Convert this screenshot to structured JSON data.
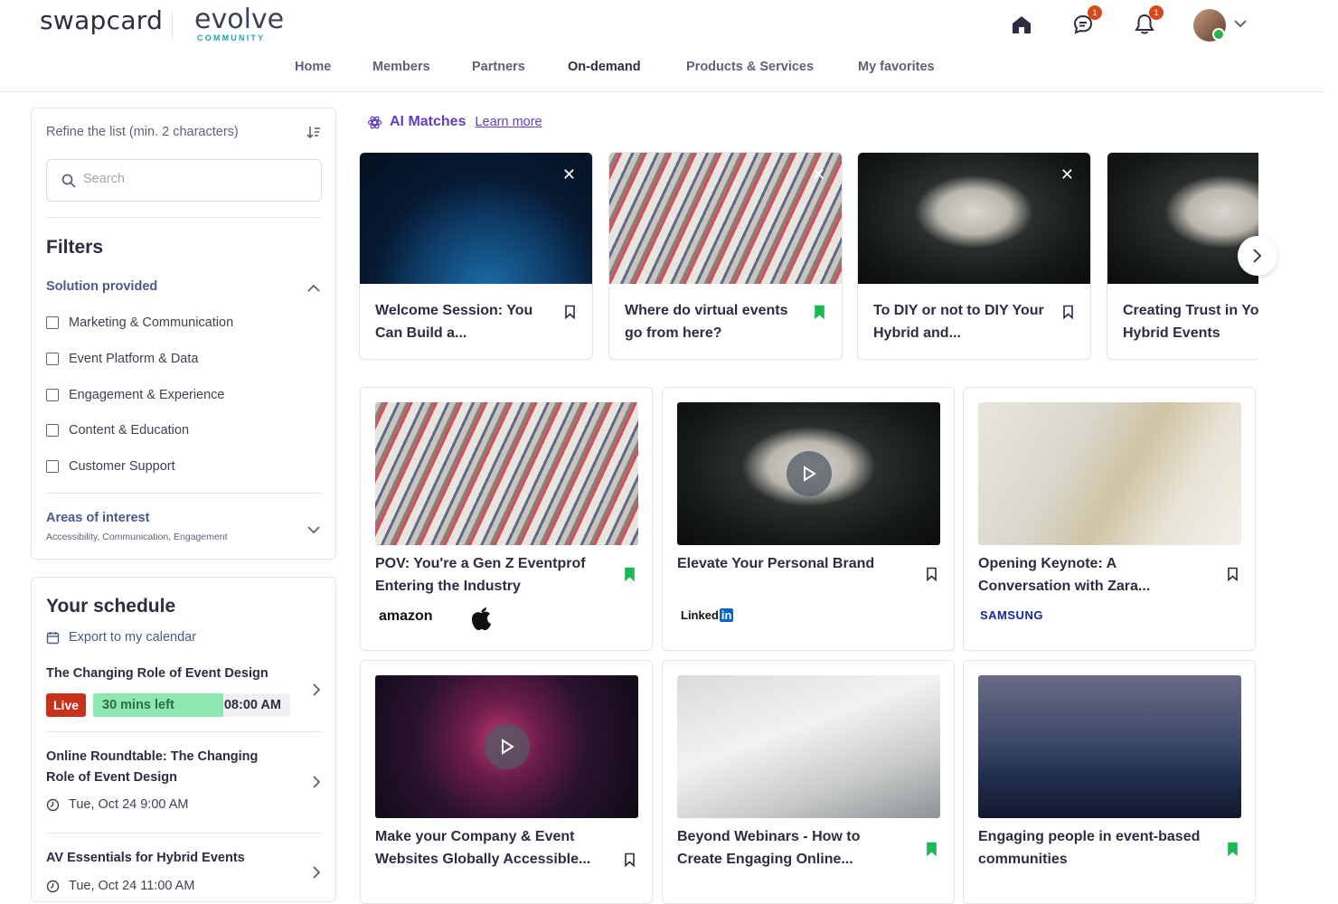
{
  "header": {
    "logo_swap": "swapcard",
    "logo_evolve": "evolve",
    "logo_community": "COMMUNITY",
    "chat_badge": "1",
    "notif_badge": "1"
  },
  "nav": {
    "items": [
      "Home",
      "Members",
      "Partners",
      "On-demand",
      "Products & Services",
      "My favorites"
    ],
    "active": "On-demand"
  },
  "sidebar": {
    "refine_label": "Refine the list (min. 2 characters)",
    "search_placeholder": "Search",
    "filters_title": "Filters",
    "solution_label": "Solution provided",
    "solutions": [
      "Marketing & Communication",
      "Event Platform & Data",
      "Engagement & Experience",
      "Content & Education",
      "Customer Support"
    ],
    "areas_label": "Areas of interest",
    "areas_sub": "Accessibility, Communication, Engagement"
  },
  "schedule": {
    "title": "Your schedule",
    "export_label": "Export to my calendar",
    "items": [
      {
        "title": "The Changing Role of Event Design",
        "live": "Live",
        "time_left": "30 mins left",
        "time": "08:00 AM",
        "progress": 0.66
      },
      {
        "title": "Online Roundtable: The Changing Role of Event Design",
        "date": "Tue, Oct 24 9:00 AM"
      },
      {
        "title": "AV Essentials for Hybrid Events",
        "date": "Tue, Oct 24 11:00 AM"
      }
    ]
  },
  "ai": {
    "title": "AI Matches",
    "learn_more": "Learn more",
    "cards": [
      {
        "title": "Welcome Session: You Can Build a...",
        "bookmarked": false
      },
      {
        "title": "Where do virtual events go from here?",
        "bookmarked": true
      },
      {
        "title": "To DIY or not to DIY Your Hybrid and...",
        "bookmarked": false
      },
      {
        "title": "Creating Trust in Your Virtual & Hybrid Events",
        "bookmarked": false
      }
    ]
  },
  "grid": [
    {
      "title": "POV: You're a Gen Z Eventprof Entering the Industry",
      "bookmarked": true,
      "sponsors": [
        "amazon",
        "apple-logo"
      ]
    },
    {
      "title": "Elevate Your Personal Brand",
      "bookmarked": false,
      "sponsors": [
        "Linked",
        "in"
      ]
    },
    {
      "title": "Opening Keynote: A Conversation with Zara...",
      "bookmarked": false,
      "sponsors": [
        "SAMSUNG"
      ]
    },
    {
      "title": "Make your Company & Event Websites Globally Accessible...",
      "bookmarked": false
    },
    {
      "title": "Beyond Webinars - How to Create Engaging Online...",
      "bookmarked": true
    },
    {
      "title": "Engaging people in event-based communities",
      "bookmarked": true
    }
  ],
  "colors": {
    "accent": "#5f3dc4",
    "bookmark_active": "#1db954",
    "live": "#c9321a",
    "progress": "#8de8b0"
  }
}
